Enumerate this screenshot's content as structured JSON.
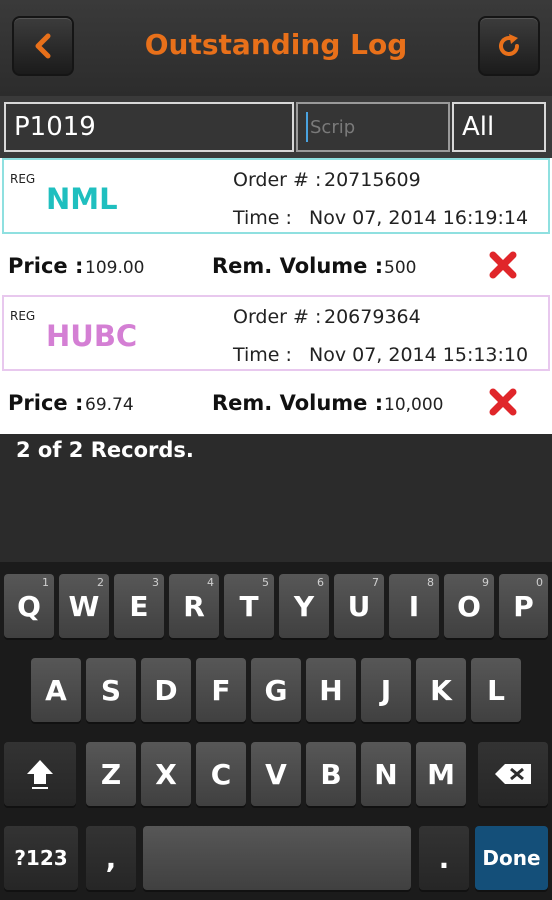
{
  "header": {
    "title": "Outstanding Log",
    "back_icon": "back-arrow-icon",
    "refresh_icon": "refresh-icon",
    "accent": "#e8701a"
  },
  "filters": {
    "account_value": "P1019",
    "scrip_placeholder": "Scrip",
    "type_value": "All"
  },
  "orders": [
    {
      "market": "REG",
      "symbol": "NML",
      "symbol_color": "#1fbfbf",
      "order_label": "Order # :",
      "order_no": "20715609",
      "time_label": "Time :",
      "time": "Nov 07, 2014 16:19:14",
      "price_label": "Price :",
      "price": "109.00",
      "volume_label": "Rem. Volume :",
      "volume": "500"
    },
    {
      "market": "REG",
      "symbol": "HUBC",
      "symbol_color": "#d47fd4",
      "order_label": "Order # :",
      "order_no": "20679364",
      "time_label": "Time :",
      "time": "Nov 07, 2014 15:13:10",
      "price_label": "Price :",
      "price": "69.74",
      "volume_label": "Rem. Volume :",
      "volume": "10,000"
    }
  ],
  "records_text": "2 of 2 Records.",
  "keyboard": {
    "row1": [
      {
        "k": "Q",
        "n": "1"
      },
      {
        "k": "W",
        "n": "2"
      },
      {
        "k": "E",
        "n": "3"
      },
      {
        "k": "R",
        "n": "4"
      },
      {
        "k": "T",
        "n": "5"
      },
      {
        "k": "Y",
        "n": "6"
      },
      {
        "k": "U",
        "n": "7"
      },
      {
        "k": "I",
        "n": "8"
      },
      {
        "k": "O",
        "n": "9"
      },
      {
        "k": "P",
        "n": "0"
      }
    ],
    "row2": [
      "A",
      "S",
      "D",
      "F",
      "G",
      "H",
      "J",
      "K",
      "L"
    ],
    "row3": [
      "Z",
      "X",
      "C",
      "V",
      "B",
      "N",
      "M"
    ],
    "sym_key": "?123",
    "comma": ",",
    "period": ".",
    "done": "Done"
  }
}
